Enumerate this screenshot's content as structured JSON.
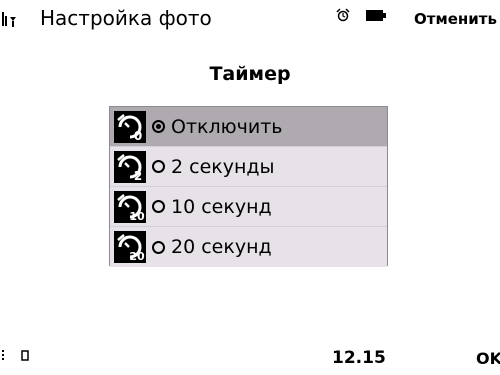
{
  "status_bar": {
    "title": "Настройка фото",
    "cancel_label": "Отменить",
    "icons": [
      "signal-icon",
      "alarm-icon",
      "battery-icon"
    ]
  },
  "dialog": {
    "title": "Таймер",
    "options": [
      {
        "label": "Отключить",
        "icon": "timer-off-icon",
        "icon_text": "0",
        "selected": true
      },
      {
        "label": "2 секунды",
        "icon": "timer-2s-icon",
        "icon_text": "2",
        "selected": false
      },
      {
        "label": "10 секунд",
        "icon": "timer-10s-icon",
        "icon_text": "10",
        "selected": false
      },
      {
        "label": "20 секунд",
        "icon": "timer-20s-icon",
        "icon_text": "20",
        "selected": false
      }
    ]
  },
  "bottom_bar": {
    "time": "12.15",
    "ok_label": "OK"
  },
  "colors": {
    "selected_row": "#aeaaaf",
    "row_background": "#e6e2e8",
    "list_border": "#8e8a92"
  }
}
